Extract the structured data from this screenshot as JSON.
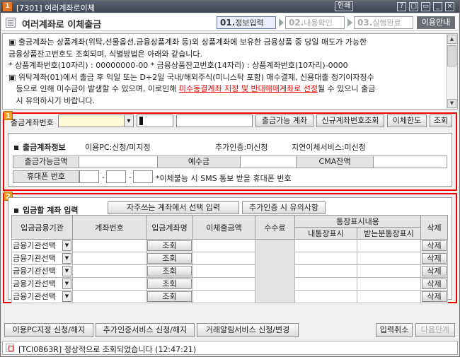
{
  "window": {
    "title": "[7301] 여러계좌로이체",
    "title_bar_links": [
      "인쇄"
    ],
    "controls": [
      "?",
      "□",
      "▭",
      "_",
      "×"
    ]
  },
  "header": {
    "title": "여러계좌로 이체출금",
    "steps": [
      {
        "num": "01.",
        "label": "정보입력",
        "active": true
      },
      {
        "num": "02.",
        "label": "내용확인",
        "active": false
      },
      {
        "num": "03.",
        "label": "실행완료",
        "active": false
      }
    ],
    "guide_label": "이용안내"
  },
  "info": {
    "lines": [
      "▣ 출금계좌는 상품계좌(위탁,선물옵션,금융상품계좌 등)외 상품계좌에 보유한 금융상품 중 당일 매도가 가능한",
      "   금융상품잔고번호도 조회되며, 식별방법은 아래와 같습니다.",
      "   * 상품계좌번호(10자리) : 00000000-00 * 금융상품잔고번호(14자리) : 상품계좌번호(10자리)-0000",
      "▣ 위탁계좌(01)에서 출금 후 익일 또는 D+2일 국내/해외주식(미니스탁 포함) 매수결제, 신용대출 정기이자징수",
      "   등으로 인해 미수금이 발생할 수 있으며, 이로인해 "
    ],
    "red_text": "미수동결계좌 지정 및 반대매매계좌로 선정",
    "after_red": "될 수 있으니 출금",
    "last_line": "   시 유의하시기 바랍니다."
  },
  "section1": {
    "badge": "1",
    "account_label": "출금계좌번호",
    "buttons": [
      "출금가능 계좌",
      "신규계좌번호조회",
      "이체한도",
      "조회"
    ]
  },
  "account_info": {
    "heading": "출금계좌정보",
    "pc_status": "이용PC:신청/미지정",
    "extra_auth": "추가인증:미신청",
    "delay_service": "지연이체서비스:미신청",
    "fields": [
      "출금가능금액",
      "예수금",
      "CMA잔액"
    ],
    "phone_label": "휴대폰 번호",
    "phone_note": "*이체불능 시 SMS 통보 받을 휴대폰 번호"
  },
  "section2": {
    "badge": "2",
    "heading": "입금할 계좌 입력",
    "buttons": [
      "자주쓰는 계좌에서 선택 입력",
      "추가인증 시 유의사항"
    ],
    "columns": [
      "입금금융기관",
      "계좌번호",
      "입금계좌명",
      "이체출금액",
      "수수료",
      "통장표시내용",
      "내통장표시",
      "받는분통장표시",
      "삭제"
    ],
    "rows": [
      {
        "bank": "금융기관선택",
        "lookup": "조회",
        "delete": "삭제"
      },
      {
        "bank": "금융기관선택",
        "lookup": "조회",
        "delete": "삭제"
      },
      {
        "bank": "금융기관선택",
        "lookup": "조회",
        "delete": "삭제"
      },
      {
        "bank": "금융기관선택",
        "lookup": "조회",
        "delete": "삭제"
      },
      {
        "bank": "금융기관선택",
        "lookup": "조회",
        "delete": "삭제"
      }
    ]
  },
  "bottom": {
    "buttons": [
      "이용PC지정 신청/해지",
      "추가인증서비스 신청/해지",
      "거래알림서비스 신청/변경"
    ],
    "cancel": "입력취소",
    "next": "다음단계"
  },
  "status": {
    "text": "[TCI0863R] 정상적으로 조회되었습니다 (12:47:21)"
  },
  "colors": {
    "accent_red": "#e00000",
    "badge_orange": "#f29b1f",
    "titlebar": "#4a5261"
  }
}
